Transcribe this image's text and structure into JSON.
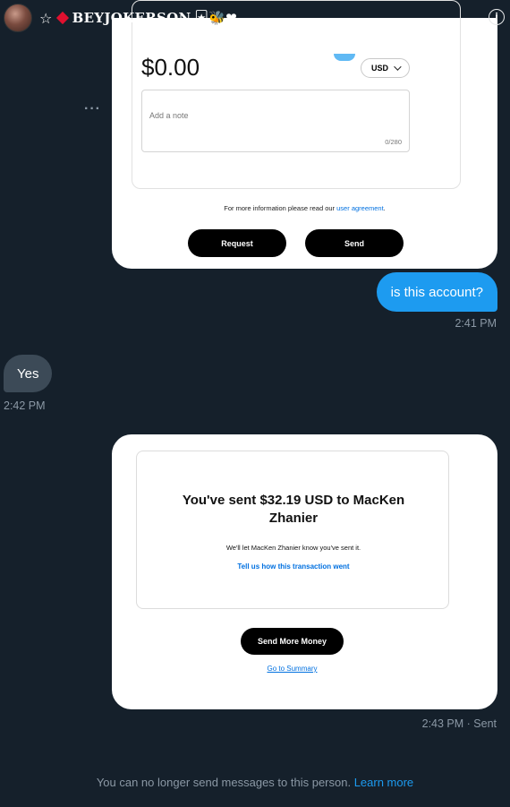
{
  "header": {
    "name_prefix": "☆",
    "name": "BEYJOKERSON",
    "name_suffix": "🃏🐝❤",
    "info_icon": "info-circle-icon"
  },
  "payment_card": {
    "amount": "$0.00",
    "currency": "USD",
    "note_placeholder": "Add a note",
    "note_counter": "0/280",
    "agreement_text": "For more information please read our ",
    "agreement_link": "user agreement",
    "agreement_end": ".",
    "request_label": "Request",
    "send_label": "Send"
  },
  "more_options_icon": "more-horizontal-icon",
  "messages": {
    "outgoing_1": "is this account?",
    "outgoing_1_time": "2:41 PM",
    "incoming_1": "Yes",
    "incoming_1_time": "2:42 PM"
  },
  "sent_card": {
    "title": "You've sent $32.19 USD to MacKen Zhanier",
    "subtitle": "We'll let MacKen Zhanier know you've sent it.",
    "feedback_link": "Tell us how this transaction went",
    "send_more_label": "Send More Money",
    "summary_link": "Go to Summary",
    "time": "2:43 PM · Sent"
  },
  "footer": {
    "text": "You can no longer send messages to this person. ",
    "link": "Learn more"
  },
  "colors": {
    "background": "#15202b",
    "accent": "#1d9bf0",
    "incoming_bubble": "#3c4a57",
    "paypal_link": "#0070e0"
  }
}
